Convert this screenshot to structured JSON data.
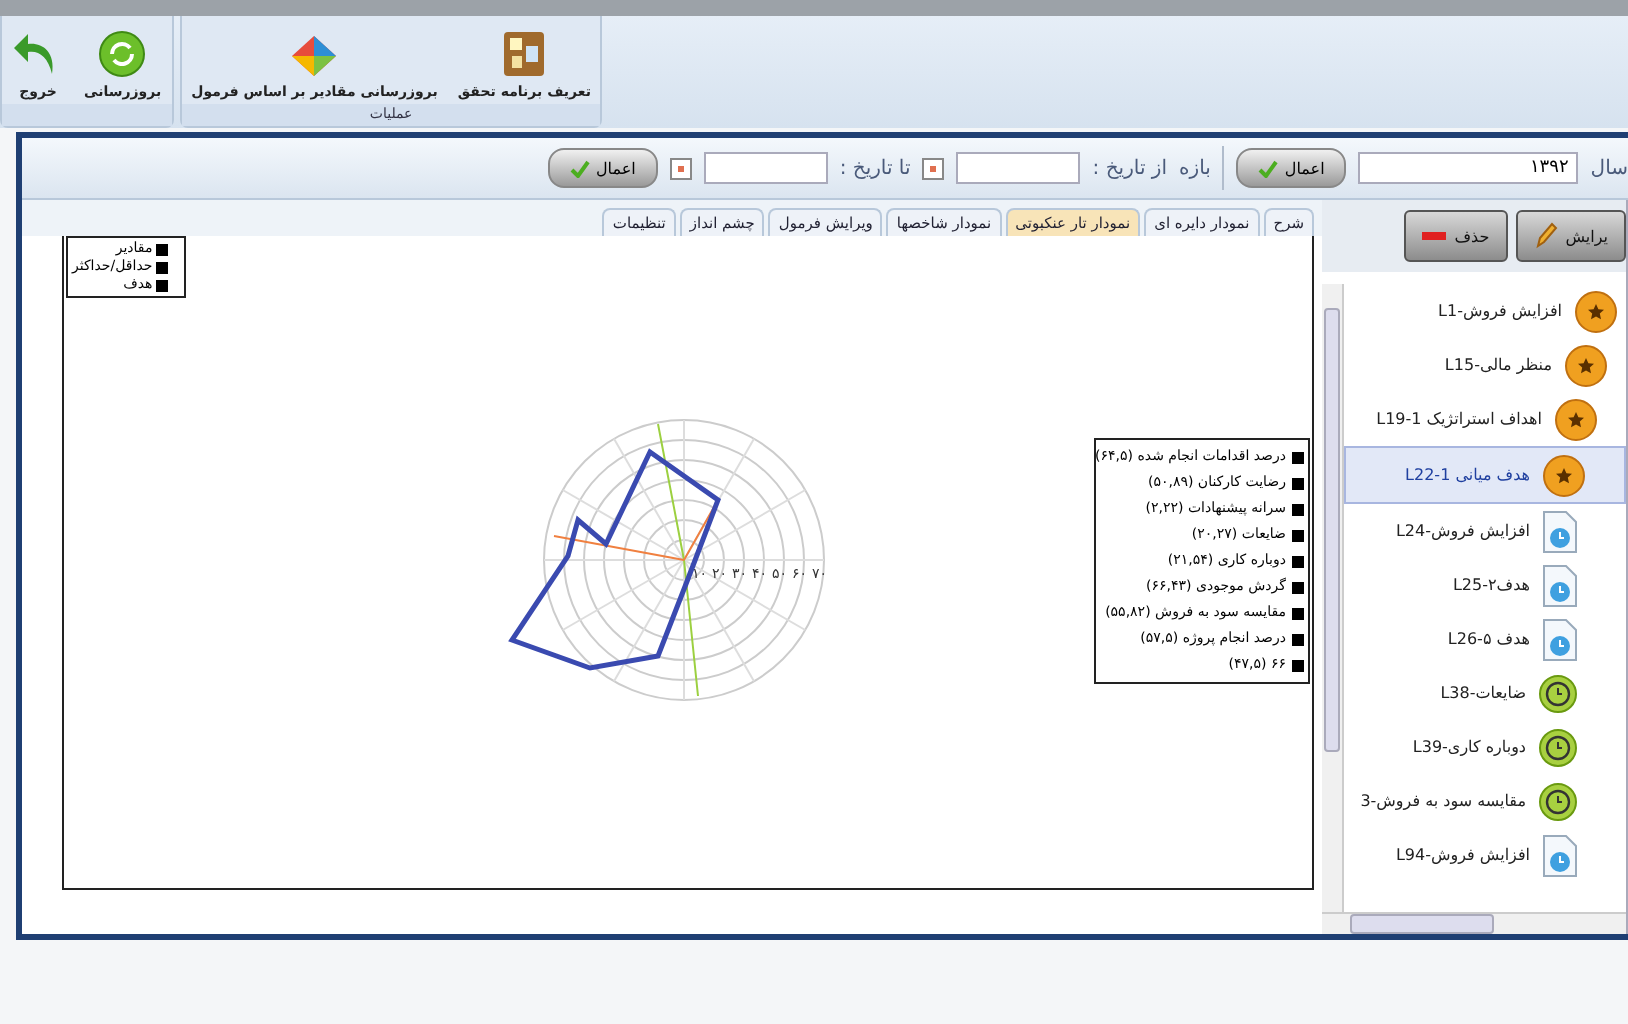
{
  "ribbon": {
    "groups": [
      {
        "label": "عملیات",
        "buttons": [
          {
            "kind": "board",
            "label": "تعریف برنامه تحقق"
          },
          {
            "kind": "formula",
            "label": "بروزرسانی مقادیر بر اساس فرمول"
          }
        ]
      },
      {
        "buttons": [
          {
            "kind": "refresh",
            "label": "بروزرسانی"
          },
          {
            "kind": "exit",
            "label": "خروج"
          }
        ]
      }
    ]
  },
  "toolbar": {
    "year_label": "سال",
    "year_value": "۱۳۹۲",
    "apply_label": "اعمال",
    "range_label": "بازه",
    "from_label": "از تاریخ :",
    "to_label": "تا تاریخ :",
    "apply2_label": "اعمال"
  },
  "tabs": [
    {
      "label": "شرح",
      "selected": false
    },
    {
      "label": "نمودار دایره ای",
      "selected": false
    },
    {
      "label": "نمودار تار عنکبوتی",
      "selected": true
    },
    {
      "label": "نمودار شاخصها",
      "selected": false
    },
    {
      "label": "ویرایش فرمول",
      "selected": false
    },
    {
      "label": "چشم انداز",
      "selected": false
    },
    {
      "label": "تنظیمات",
      "selected": false
    }
  ],
  "chart": {
    "series_legend": [
      "مقادیر",
      "حداقل/حداکثر",
      "هدف"
    ],
    "axis_ticks": [
      "۷۰",
      "۶۰",
      "۵۰",
      "۴۰",
      "۳۰",
      "۲۰",
      "۱۰"
    ],
    "legend": [
      "درصد اقدامات انجام شده (۶۴,۵)",
      "رضایت کارکنان (۵۰,۸۹)",
      "سرانه پیشنهادات (۲,۲۲)",
      "ضایعات (۲۰,۲۷)",
      "دوباره کاری (۲۱,۵۴)",
      "گردش موجودی (۶۶,۴۳)",
      "مقایسه سود به فروش (۵۵,۸۲)",
      "درصد انجام پروژه (۵۷,۵)",
      "۶۶ (۴۷,۵)"
    ]
  },
  "side_buttons": [
    {
      "kind": "edit",
      "label": "یرایش"
    },
    {
      "kind": "delete",
      "label": "حذف"
    }
  ],
  "tree": [
    {
      "kind": "star",
      "label": "افزایش فروش-L1",
      "selected": false,
      "children": [
        {
          "kind": "star",
          "label": "منظر مالی-L15",
          "selected": false,
          "children": [
            {
              "kind": "star",
              "label": "اهداف استراتژیک L19-1",
              "selected": false,
              "children": [
                {
                  "kind": "star",
                  "label": "هدف میانی L22-1",
                  "selected": true,
                  "children": [
                    {
                      "kind": "doc",
                      "label": "افزایش فروش-L24",
                      "selected": false
                    },
                    {
                      "kind": "doc",
                      "label": "هدف۲-L25",
                      "selected": false
                    },
                    {
                      "kind": "doc",
                      "label": "هدف ۵-L26",
                      "selected": false
                    },
                    {
                      "kind": "clock",
                      "label": "ضایعات-L38",
                      "selected": false
                    },
                    {
                      "kind": "clock",
                      "label": "دوباره کاری-L39",
                      "selected": false
                    },
                    {
                      "kind": "clock",
                      "label": "مقایسه سود به فروش-3",
                      "selected": false
                    },
                    {
                      "kind": "doc",
                      "label": "افزایش فروش-L94",
                      "selected": false
                    }
                  ]
                }
              ]
            }
          ]
        }
      ]
    }
  ]
}
